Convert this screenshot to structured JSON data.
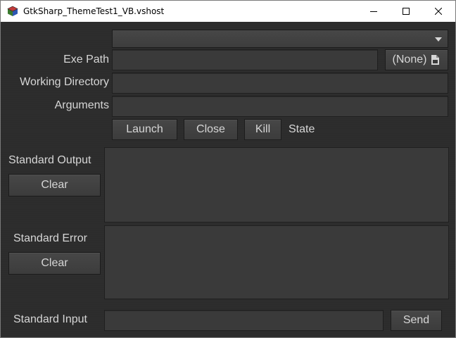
{
  "window": {
    "title": "GtkSharp_ThemeTest1_VB.vshost",
    "app_icon": "cube-icon",
    "controls": [
      "minimize-icon",
      "maximize-icon",
      "close-icon"
    ]
  },
  "form": {
    "combo_value": "",
    "exe_path_label": "Exe Path",
    "exe_path_value": "",
    "file_chooser_label": "(None)",
    "file_chooser_icon": "document-open-icon",
    "working_dir_label": "Working Directory",
    "working_dir_value": "",
    "arguments_label": "Arguments",
    "arguments_value": "",
    "launch_label": "Launch",
    "close_label": "Close",
    "kill_label": "Kill",
    "state_label": "State"
  },
  "output": {
    "stdout_label": "Standard Output",
    "stdout_clear_label": "Clear",
    "stdout_value": "",
    "stderr_label": "Standard Error",
    "stderr_clear_label": "Clear",
    "stderr_value": "",
    "stdin_label": "Standard Input",
    "stdin_value": "",
    "send_label": "Send"
  },
  "colors": {
    "background": "#2c2c2c",
    "entry": "#3a3a3a",
    "button": "#434343",
    "text": "#d6d6d6"
  }
}
